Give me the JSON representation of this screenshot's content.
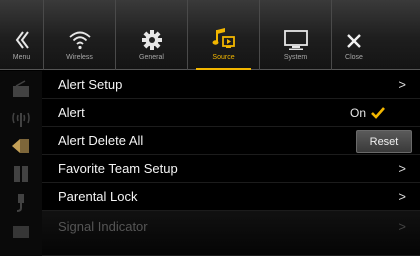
{
  "topbar": {
    "tabs": [
      {
        "label": "Menu",
        "icon": "chevron-left-icon"
      },
      {
        "label": "Wireless",
        "icon": "wifi-icon"
      },
      {
        "label": "General",
        "icon": "gear-icon"
      },
      {
        "label": "Source",
        "icon": "music-source-icon",
        "active": true
      },
      {
        "label": "System",
        "icon": "monitor-icon"
      },
      {
        "label": "Close",
        "icon": "close-icon"
      }
    ],
    "accent": "#f2b600"
  },
  "list": {
    "rows": [
      {
        "label": "Alert Setup",
        "control": "chevron"
      },
      {
        "label": "Alert",
        "control": "toggle",
        "value": "On"
      },
      {
        "label": "Alert Delete All",
        "control": "button",
        "button_label": "Reset"
      },
      {
        "label": "Favorite Team Setup",
        "control": "chevron"
      },
      {
        "label": "Parental Lock",
        "control": "chevron"
      },
      {
        "label": "Signal Indicator",
        "control": "chevron",
        "dimmed": true
      }
    ]
  }
}
